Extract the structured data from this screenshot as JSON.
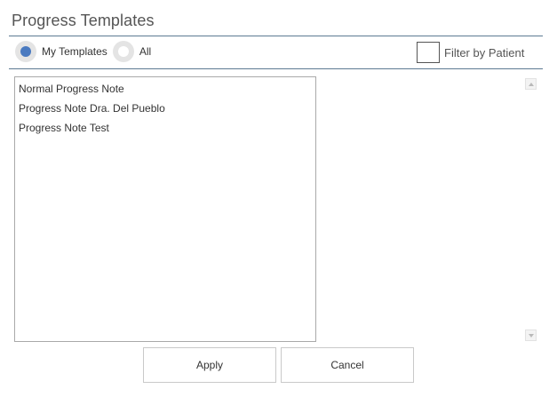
{
  "header": {
    "title": "Progress Templates"
  },
  "scope": {
    "options": [
      {
        "label": "My Templates",
        "selected": true
      },
      {
        "label": "All",
        "selected": false
      }
    ]
  },
  "filter": {
    "label": "Filter by Patient",
    "checked": false
  },
  "templates": {
    "items": [
      "Normal Progress Note",
      "Progress Note Dra. Del Pueblo",
      "Progress Note Test"
    ]
  },
  "actions": {
    "apply_label": "Apply",
    "cancel_label": "Cancel"
  },
  "colors": {
    "accent": "#4a7ac0",
    "divider": "#5d7a93"
  },
  "icons": {
    "scroll_up": "chevron-up-icon",
    "scroll_down": "chevron-down-icon"
  }
}
